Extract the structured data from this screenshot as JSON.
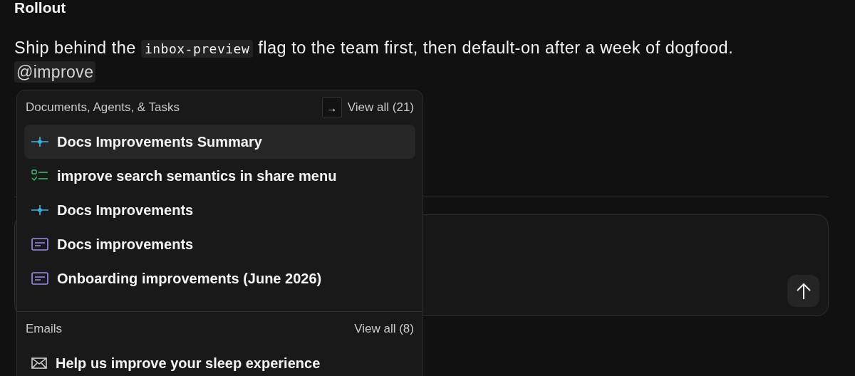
{
  "heading": "Rollout",
  "paragraph": {
    "before": "Ship behind the",
    "code": "inbox-preview",
    "after": "flag to the team first, then default-on after a week of dogfood."
  },
  "mention": "@improve",
  "composer": {
    "send_button": true
  },
  "menu": {
    "sections": [
      {
        "title": "Documents, Agents, & Tasks",
        "shortcut": "→",
        "view_all": "View all (21)",
        "items": [
          {
            "kind": "agent",
            "label": "Docs Improvements Summary",
            "selected": true
          },
          {
            "kind": "task",
            "label": "improve search semantics in share menu",
            "selected": false
          },
          {
            "kind": "agent",
            "label": "Docs Improvements",
            "selected": false
          },
          {
            "kind": "document",
            "label": "Docs improvements",
            "selected": false
          },
          {
            "kind": "document",
            "label": "Onboarding improvements (June 2026)",
            "selected": false
          }
        ]
      },
      {
        "title": "Emails",
        "view_all": "View all (8)",
        "items": [
          {
            "kind": "email",
            "label": "Help us improve your sleep experience",
            "selected": false
          }
        ]
      }
    ]
  }
}
